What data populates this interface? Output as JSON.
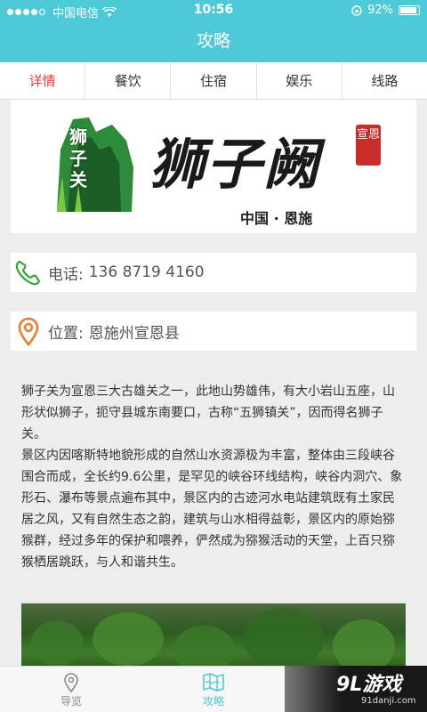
{
  "statusbar": {
    "carrier": "中国电信",
    "time": "10:56",
    "battery_pct": "92%",
    "battery_level": 0.92
  },
  "header": {
    "title": "攻略"
  },
  "tabs": [
    {
      "label": "详情",
      "active": true
    },
    {
      "label": "餐饮"
    },
    {
      "label": "住宿"
    },
    {
      "label": "娱乐"
    },
    {
      "label": "线路"
    }
  ],
  "banner": {
    "brand": "狮子阙",
    "vertical": "狮子关",
    "seal": "宣恩",
    "subtitle": "中国 · 恩施"
  },
  "phone": {
    "label": "电话:",
    "value": "136 8719 4160",
    "icon": "phone-icon"
  },
  "location": {
    "label": "位置:",
    "value": "恩施州宣恩县",
    "icon": "location-pin-icon"
  },
  "description": {
    "p1": "狮子关为宣恩三大古雄关之一，此地山势雄伟，有大小岩山五座，山形状似狮子，扼守县城东南要口，古称“五狮镇关”，因而得名狮子关。",
    "p2": "景区内因喀斯特地貌形成的自然山水资源极为丰富，整体由三段峡谷围合而成，全长约9.6公里，是罕见的峡谷环线结构，峡谷内洞穴、象形石、瀑布等景点遍布其中，景区内的古迹河水电站建筑既有土家民居之风，又有自然生态之韵，建筑与山水相得益彰，景区内的原始猕猴群，经过多年的保护和喂养，俨然成为猕猴活动的天堂，上百只猕猴栖居跳跃，与人和谐共生。"
  },
  "bottom_nav": [
    {
      "label": "导览",
      "icon": "map-pin-icon",
      "active": false
    },
    {
      "label": "攻略",
      "icon": "book-map-icon",
      "active": true
    }
  ],
  "watermark": {
    "main": "9L游戏",
    "sub": "91danji.com"
  },
  "colors": {
    "accent": "#4ec9d8",
    "active_tab": "#e23b3b",
    "phone_icon": "#3aa53a",
    "pin_icon": "#ef7a2a"
  }
}
